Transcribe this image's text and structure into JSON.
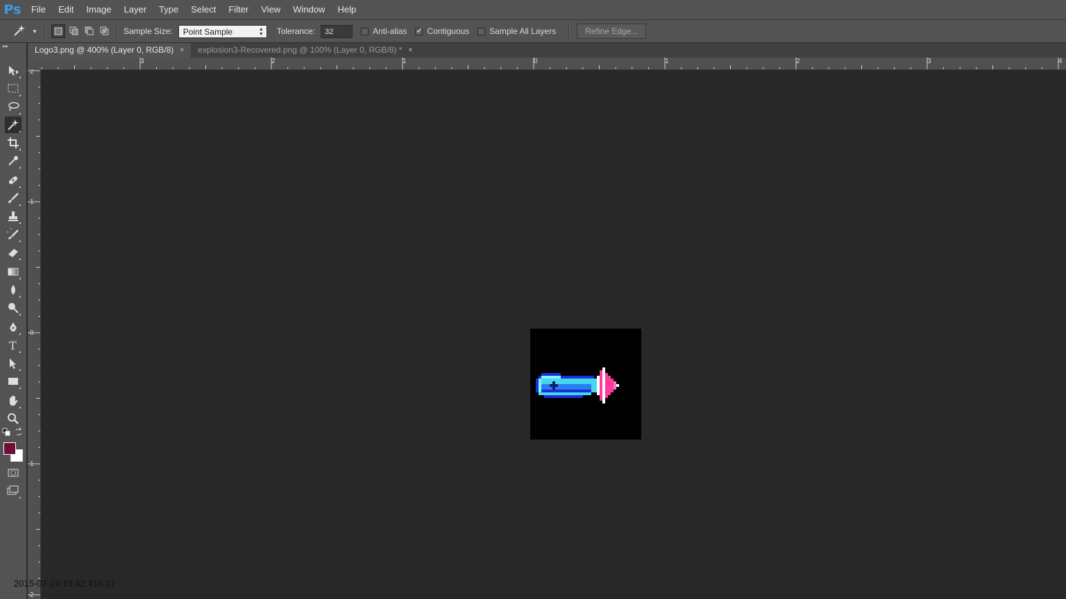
{
  "app": {
    "logo": "Ps"
  },
  "menu": [
    "File",
    "Edit",
    "Image",
    "Layer",
    "Type",
    "Select",
    "Filter",
    "View",
    "Window",
    "Help"
  ],
  "options": {
    "sample_size_label": "Sample Size:",
    "sample_size_value": "Point Sample",
    "tolerance_label": "Tolerance:",
    "tolerance_value": "32",
    "anti_alias_label": "Anti-alias",
    "anti_alias_checked": false,
    "contiguous_label": "Contiguous",
    "contiguous_checked": true,
    "sample_all_layers_label": "Sample All Layers",
    "sample_all_layers_checked": false,
    "refine_edge_label": "Refine Edge..."
  },
  "tabs": [
    {
      "label": "Logo3.png @ 400% (Layer 0, RGB/8)",
      "close": "×",
      "active": true
    },
    {
      "label": "explosion3-Recovered.png @ 100% (Layer 0, RGB/8) *",
      "close": "×",
      "active": false
    }
  ],
  "ruler_h": [
    "3",
    "2",
    "1",
    "0",
    "1",
    "2",
    "3",
    "4"
  ],
  "ruler_v": [
    "2",
    "1",
    "0",
    "1",
    "2"
  ],
  "colors": {
    "foreground": "#6e0f37",
    "background": "#ffffff",
    "accent": "#3d9ae8"
  },
  "tools": [
    "move-icon",
    "marquee-icon",
    "lasso-icon",
    "magic-wand-icon",
    "crop-icon",
    "eyedropper-icon",
    "healing-brush-icon",
    "brush-icon",
    "clone-stamp-icon",
    "history-brush-icon",
    "eraser-icon",
    "gradient-icon",
    "blur-icon",
    "dodge-icon",
    "pen-icon",
    "type-icon",
    "path-selection-icon",
    "rectangle-icon",
    "hand-icon",
    "zoom-icon"
  ],
  "status": "2015-07-19 19:42:410.37"
}
